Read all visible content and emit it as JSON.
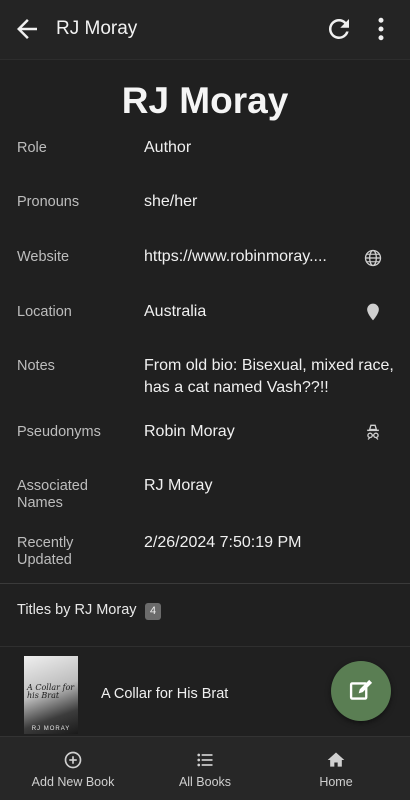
{
  "appbar": {
    "title": "RJ Moray",
    "icons": [
      "back-arrow-icon",
      "refresh-icon",
      "more-vert-icon"
    ]
  },
  "profile": {
    "name": "RJ Moray",
    "fields": [
      {
        "label": "Role",
        "value": "Author"
      },
      {
        "label": "Pronouns",
        "value": "she/her"
      },
      {
        "label": "Website",
        "value": "https://www.robinmoray....",
        "icon": "globe-icon"
      },
      {
        "label": "Location",
        "value": "Australia",
        "icon": "location-pin-icon"
      },
      {
        "label": "Notes",
        "value": "From old bio: Bisexual, mixed race, has a cat named Vash??!!"
      },
      {
        "label": "Pseudonyms",
        "value": "Robin Moray",
        "icon": "incognito-icon"
      },
      {
        "label": "Associated Names",
        "value": "RJ Moray"
      },
      {
        "label": "Recently Updated",
        "value": "2/26/2024 7:50:19 PM"
      }
    ]
  },
  "titles": {
    "heading": "Titles by RJ Moray",
    "count": "4",
    "books": [
      {
        "title": "A Collar for His Brat",
        "cover_title": "A Collar for his Brat",
        "cover_author": "RJ MORAY"
      }
    ]
  },
  "fab": {
    "icon": "edit-icon",
    "color": "#5a7e53"
  },
  "bottom_nav": [
    {
      "label": "Add New Book",
      "icon": "add-circle-icon"
    },
    {
      "label": "All Books",
      "icon": "list-icon"
    },
    {
      "label": "Home",
      "icon": "home-icon"
    }
  ]
}
